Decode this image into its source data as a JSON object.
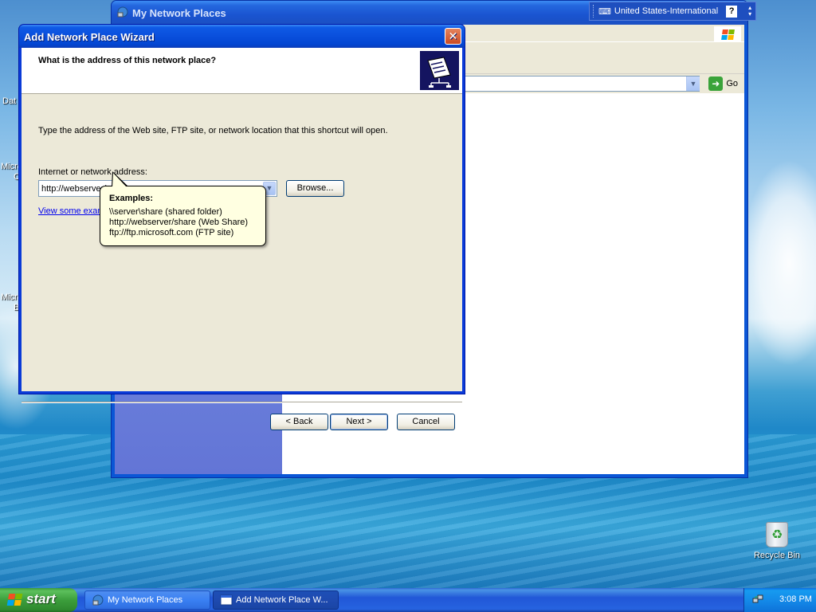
{
  "desktop": {
    "partial_labels": [
      "Dat",
      "Micro",
      "C",
      "Micro",
      "B"
    ],
    "recycle_bin_label": "Recycle Bin"
  },
  "explorer": {
    "title": "My Network Places",
    "go_label": "Go"
  },
  "language_bar": {
    "language": "United States-International",
    "help": "?"
  },
  "wizard": {
    "title": "Add Network Place Wizard",
    "heading": "What is the address of this network place?",
    "description": "Type the address of the Web site, FTP site, or network location that this shortcut will open.",
    "address_label": "Internet or network address:",
    "address_value": "http://webserver/",
    "browse_label": "Browse...",
    "link_text": "View some exam",
    "back_label": "< Back",
    "next_label": "Next >",
    "cancel_label": "Cancel",
    "close_glyph": "✕"
  },
  "tooltip": {
    "title": "Examples:",
    "lines": [
      "\\\\server\\share   (shared folder)",
      "http://webserver/share   (Web Share)",
      "ftp://ftp.microsoft.com   (FTP site)"
    ]
  },
  "taskbar": {
    "start_label": "start",
    "tasks": [
      {
        "label": "My Network Places",
        "active": false
      },
      {
        "label": "Add Network Place W...",
        "active": true
      }
    ],
    "clock": "3:08 PM"
  },
  "colors": {
    "xp_blue": "#0a3bd8",
    "dialog_face": "#ece9d8",
    "tooltip_bg": "#ffffe1",
    "start_green": "#3c9e3c"
  },
  "icons": {
    "network_places": "network-places-icon",
    "wizard_header": "network-folder-icon",
    "go": "go-arrow-icon",
    "recycle": "recycle-bin-icon"
  }
}
